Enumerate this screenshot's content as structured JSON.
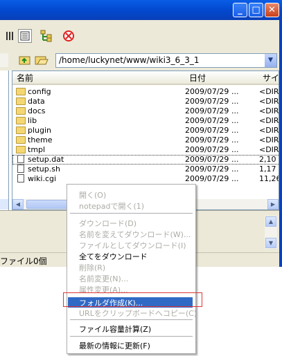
{
  "window": {
    "minimize_label": "_",
    "maximize_label": "□",
    "close_label": "✕"
  },
  "toolbar": {
    "icons": [
      "details-view-icon",
      "list-view-icon",
      "tree-icon",
      "stop-icon"
    ]
  },
  "address": {
    "path": "/home/luckynet/www/wiki3_6_3_1"
  },
  "file_list": {
    "columns": [
      "名前",
      "日付",
      "サイズ"
    ],
    "header_visible": [
      "名前",
      "日付",
      "サイ"
    ],
    "rows": [
      {
        "name": "config",
        "type": "folder",
        "date": "2009/07/29",
        "more": "...",
        "size": "<DIR"
      },
      {
        "name": "data",
        "type": "folder",
        "date": "2009/07/29",
        "more": "...",
        "size": "<DIR"
      },
      {
        "name": "docs",
        "type": "folder",
        "date": "2009/07/29",
        "more": "...",
        "size": "<DIR"
      },
      {
        "name": "lib",
        "type": "folder",
        "date": "2009/07/29",
        "more": "...",
        "size": "<DIR"
      },
      {
        "name": "plugin",
        "type": "folder",
        "date": "2009/07/29",
        "more": "...",
        "size": "<DIR"
      },
      {
        "name": "theme",
        "type": "folder",
        "date": "2009/07/29",
        "more": "...",
        "size": "<DIR"
      },
      {
        "name": "tmpl",
        "type": "folder",
        "date": "2009/07/29",
        "more": "...",
        "size": "<DIR"
      },
      {
        "name": "setup.dat",
        "type": "file",
        "date": "2009/07/29",
        "more": "...",
        "size": "2,10"
      },
      {
        "name": "setup.sh",
        "type": "file",
        "date": "2009/07/29",
        "more": "...",
        "size": "1,17"
      },
      {
        "name": "wiki.cgi",
        "type": "file",
        "date": "2009/07/29",
        "more": "...",
        "size": "11,26"
      }
    ]
  },
  "status": {
    "text": "ファイル0個"
  },
  "context_menu": {
    "items": [
      {
        "label": "開く(O)",
        "disabled": true
      },
      {
        "label": "notepadで開く(1)",
        "disabled": true
      },
      {
        "separator": true
      },
      {
        "label": "ダウンロード(D)",
        "disabled": true
      },
      {
        "label": "名前を変えてダウンロード(W)...",
        "disabled": true
      },
      {
        "label": "ファイルとしてダウンロード(I)",
        "disabled": true
      },
      {
        "label": "全てをダウンロード",
        "disabled": false
      },
      {
        "label": "削除(R)",
        "disabled": true
      },
      {
        "label": "名前変更(N)...",
        "disabled": true
      },
      {
        "label": "属性変更(A)...",
        "disabled": true
      },
      {
        "label": "フォルダ作成(K)...",
        "disabled": false,
        "highlighted": true
      },
      {
        "label": "URLをクリップボードへコピー(C)",
        "disabled": true
      },
      {
        "separator": true
      },
      {
        "label": "ファイル容量計算(Z)",
        "disabled": false
      },
      {
        "separator": true
      },
      {
        "label": "最新の情報に更新(F)",
        "disabled": false
      }
    ]
  },
  "colors": {
    "titlebar": "#0a5de6",
    "highlight": "#316ac5",
    "annotation_box": "#e03434"
  }
}
